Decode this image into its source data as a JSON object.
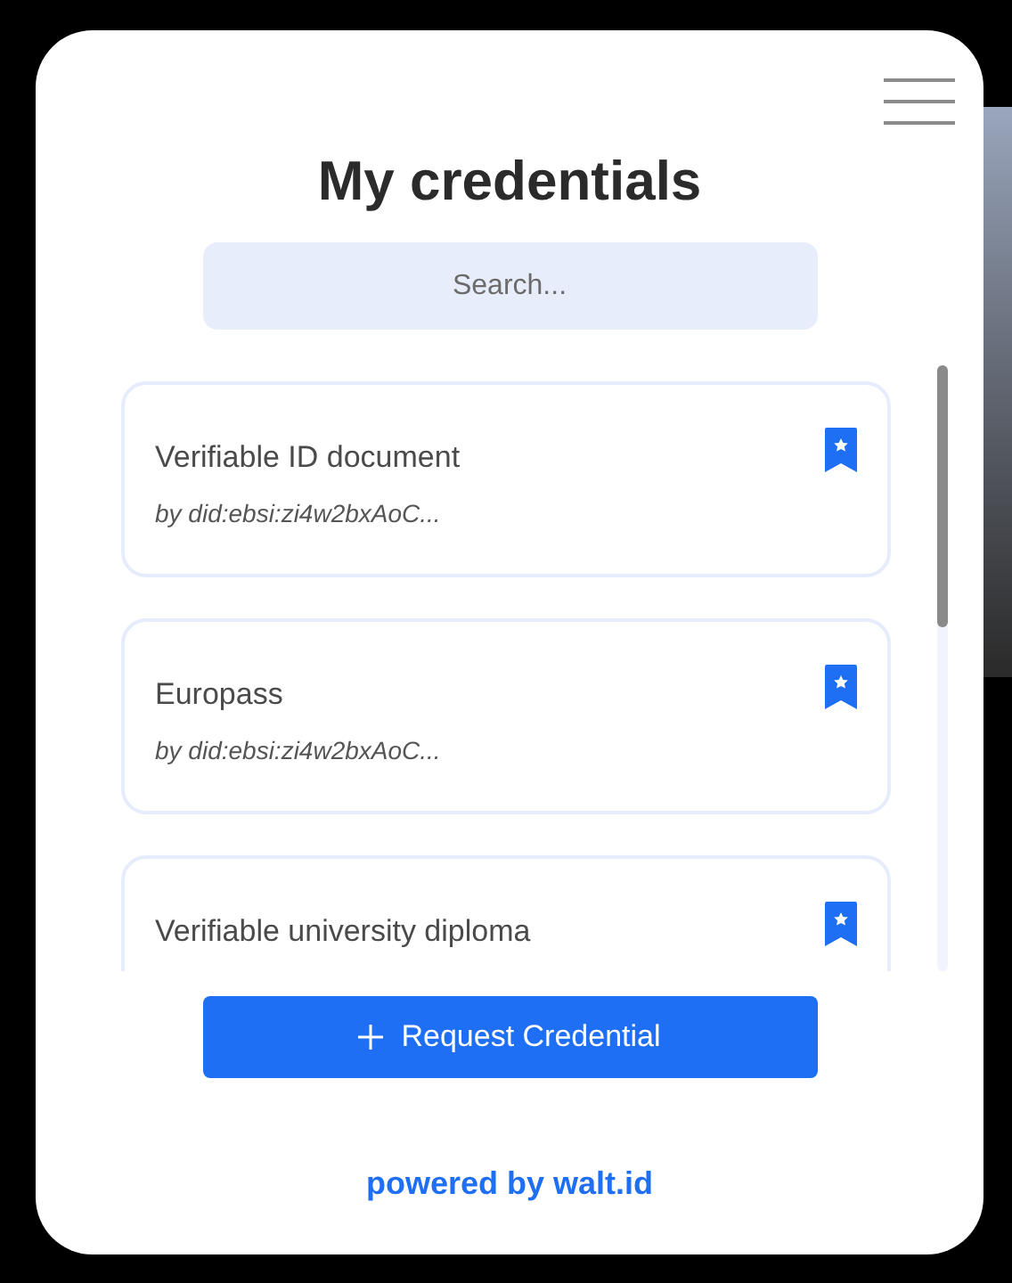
{
  "title": "My credentials",
  "search": {
    "placeholder": "Search..."
  },
  "credentials": [
    {
      "name": "Verifiable ID document",
      "issuer": "by did:ebsi:zi4w2bxAoC..."
    },
    {
      "name": "Europass",
      "issuer": "by did:ebsi:zi4w2bxAoC..."
    },
    {
      "name": "Verifiable university diploma"
    }
  ],
  "request_button": {
    "label": "Request Credential"
  },
  "footer": {
    "link": "powered by walt.id"
  }
}
